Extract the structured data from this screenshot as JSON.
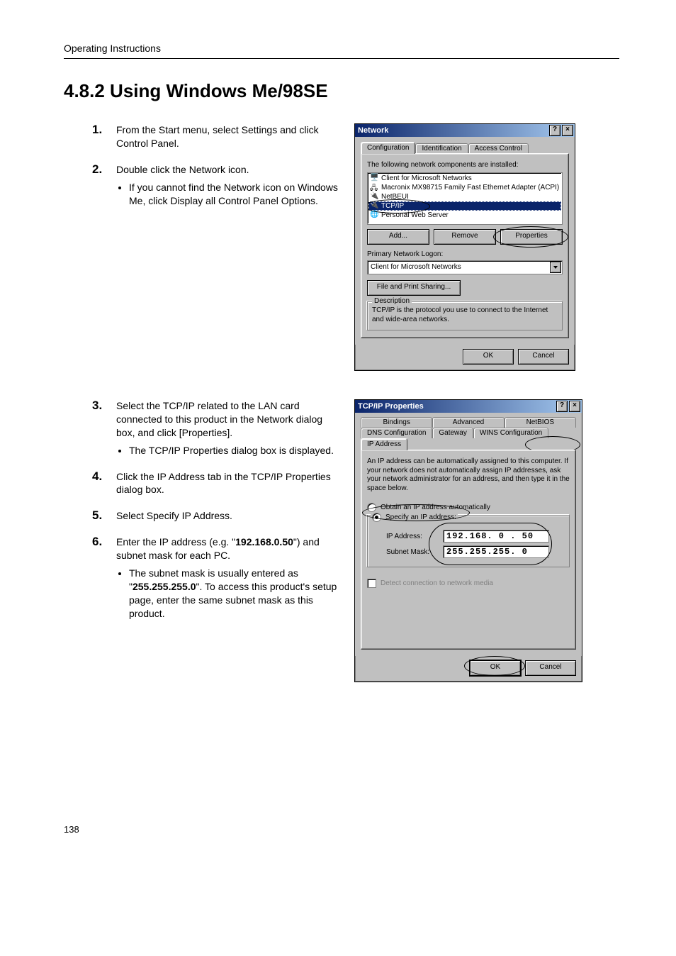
{
  "running_head": "Operating Instructions",
  "section_title": "4.8.2    Using Windows Me/98SE",
  "steps_a": [
    {
      "num": "1.",
      "text": "From the Start menu, select Settings and click Control Panel."
    },
    {
      "num": "2.",
      "text": "Double click the Network icon.",
      "bullets": [
        "If you cannot find the Network icon on Windows Me, click Display all Control Panel Options."
      ]
    }
  ],
  "steps_b": [
    {
      "num": "3.",
      "text": "Select the TCP/IP related to the LAN card connected to this product in the Network dialog box, and click [Properties].",
      "bullets": [
        "The TCP/IP Properties dialog box is displayed."
      ]
    },
    {
      "num": "4.",
      "text": "Click the IP Address tab in the TCP/IP Properties dialog box."
    },
    {
      "num": "5.",
      "text": "Select Specify IP Address."
    },
    {
      "num": "6.",
      "text_html": "Enter the IP address (e.g. \"<b>192.168.0.50</b>\") and subnet mask for each PC.",
      "bullets_html": [
        "The subnet mask is usually entered as \"<b>255.255.255.0</b>\". To access this product's setup page, enter the same subnet mask as this product."
      ]
    }
  ],
  "dlg_network": {
    "title": "Network",
    "tabs": [
      "Configuration",
      "Identification",
      "Access Control"
    ],
    "active_tab": 0,
    "list_prompt": "The following network components are installed:",
    "items": [
      "Client for Microsoft Networks",
      "Macronix MX98715 Family Fast Ethernet Adapter (ACPI)",
      "NetBEUI",
      "TCP/IP",
      "Personal Web Server"
    ],
    "selected_item": 3,
    "btn_add": "Add...",
    "btn_remove": "Remove",
    "btn_properties": "Properties",
    "primary_logon_label": "Primary Network Logon:",
    "primary_logon_value": "Client for Microsoft Networks",
    "btn_file_print": "File and Print Sharing...",
    "desc_label": "Description",
    "desc_text": "TCP/IP is the protocol you use to connect to the Internet and wide-area networks.",
    "btn_ok": "OK",
    "btn_cancel": "Cancel"
  },
  "dlg_tcpip": {
    "title": "TCP/IP Properties",
    "tabs_row1": [
      "Bindings",
      "Advanced",
      "NetBIOS"
    ],
    "tabs_row2": [
      "DNS Configuration",
      "Gateway",
      "WINS Configuration",
      "IP Address"
    ],
    "active_tab": "IP Address",
    "info_text": "An IP address can be automatically assigned to this computer. If your network does not automatically assign IP addresses, ask your network administrator for an address, and then type it in the space below.",
    "radio_obtain": "Obtain an IP address automatically",
    "radio_specify": "Specify an IP address:",
    "ip_label": "IP Address:",
    "ip_value": "192.168. 0 . 50",
    "mask_label": "Subnet Mask:",
    "mask_value": "255.255.255. 0",
    "detect_label": "Detect connection to network media",
    "btn_ok": "OK",
    "btn_cancel": "Cancel"
  },
  "page_number": "138"
}
